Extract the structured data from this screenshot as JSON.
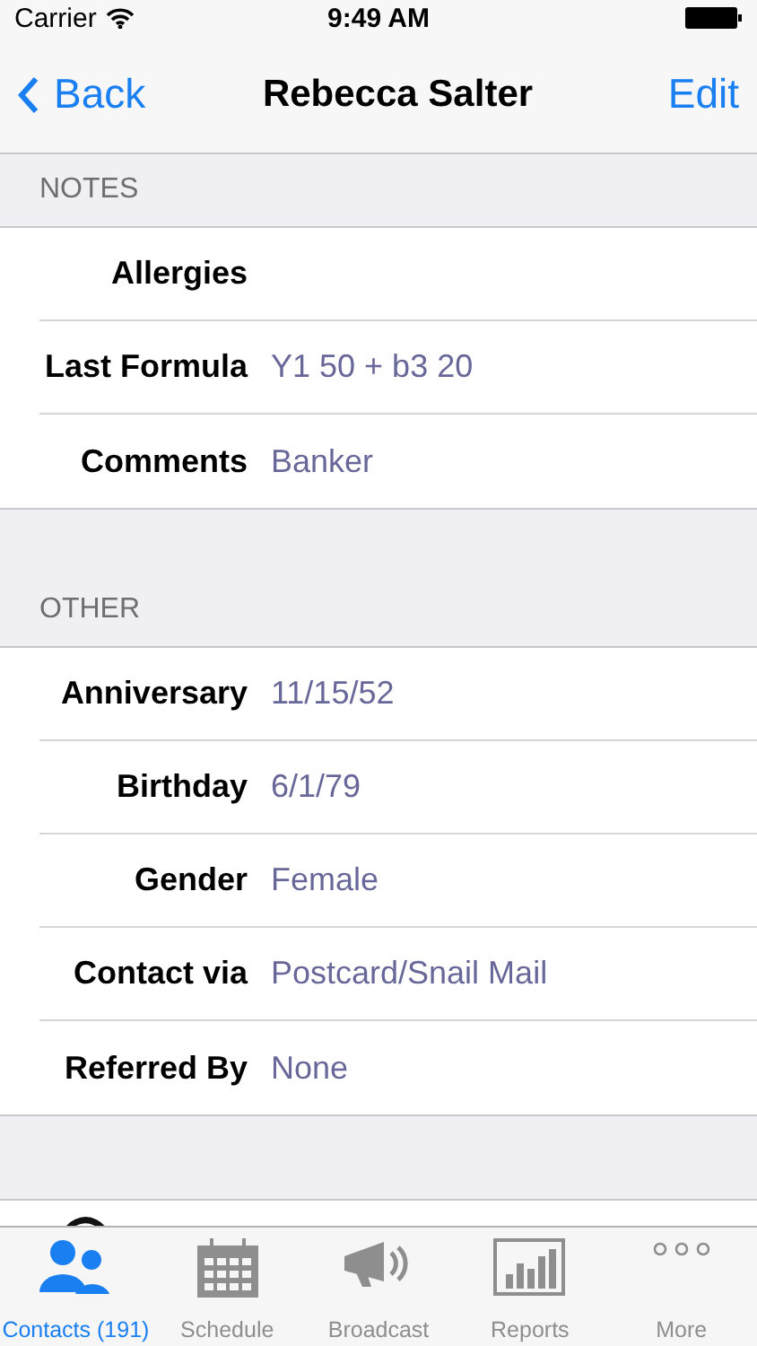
{
  "status_bar": {
    "carrier": "Carrier",
    "time": "9:49 AM"
  },
  "nav": {
    "back": "Back",
    "title": "Rebecca Salter",
    "action": "Edit"
  },
  "sections": [
    {
      "header": "NOTES",
      "rows": [
        {
          "label": "Allergies"
        },
        {
          "label": "Last Formula",
          "value": "Y1 50 + b3 20"
        },
        {
          "label": "Comments",
          "value": "Banker"
        }
      ]
    },
    {
      "header": "OTHER",
      "rows": [
        {
          "label": "Anniversary",
          "value": "11/15/52"
        },
        {
          "label": "Birthday",
          "value": "6/1/79"
        },
        {
          "label": "Gender",
          "value": "Female"
        },
        {
          "label": "Contact via",
          "value": "Postcard/Snail Mail"
        },
        {
          "label": "Referred By",
          "value": "None"
        }
      ]
    }
  ],
  "tabs": [
    {
      "kind": "contacts",
      "label": "Contacts (191)",
      "selected": true
    },
    {
      "kind": "schedule",
      "label": "Schedule",
      "selected": false
    },
    {
      "kind": "broadcast",
      "label": "Broadcast",
      "selected": false
    },
    {
      "kind": "reports",
      "label": "Reports",
      "selected": false
    },
    {
      "kind": "more",
      "label": "More",
      "selected": false
    }
  ]
}
